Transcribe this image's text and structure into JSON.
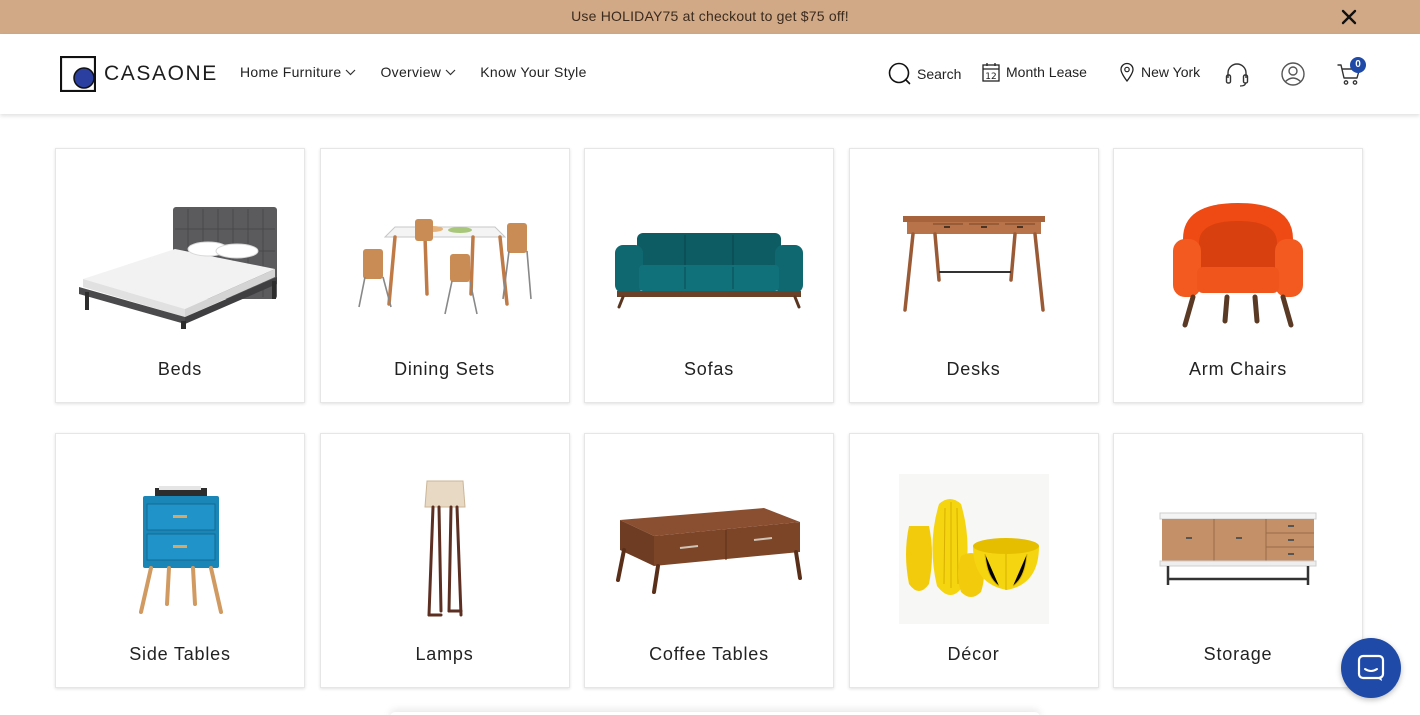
{
  "promo": {
    "text": "Use HOLIDAY75 at checkout to get $75 off!"
  },
  "header": {
    "brand": "CASAONE",
    "nav": [
      {
        "label": "Home Furniture",
        "icon": "chevron-down-icon"
      },
      {
        "label": "Overview",
        "icon": "chevron-down-icon"
      },
      {
        "label": "Know Your Style"
      }
    ],
    "utilities": {
      "search_label": "Search",
      "lease_label": "Month Lease",
      "lease_icon_number": "12",
      "location_label": "New York"
    },
    "cart_count": "0"
  },
  "categories": [
    {
      "label": "Beds",
      "icon": "bed-image"
    },
    {
      "label": "Dining Sets",
      "icon": "dining-set-image"
    },
    {
      "label": "Sofas",
      "icon": "sofa-image"
    },
    {
      "label": "Desks",
      "icon": "desk-image"
    },
    {
      "label": "Arm Chairs",
      "icon": "arm-chair-image"
    },
    {
      "label": "Side Tables",
      "icon": "side-table-image"
    },
    {
      "label": "Lamps",
      "icon": "lamp-image"
    },
    {
      "label": "Coffee Tables",
      "icon": "coffee-table-image"
    },
    {
      "label": "Décor",
      "icon": "decor-image"
    },
    {
      "label": "Storage",
      "icon": "storage-image"
    }
  ],
  "colors": {
    "promo_bg": "#d2a987",
    "accent": "#1f4aa8",
    "sofa": "#0d5c63",
    "arm_chair": "#ef4a14",
    "side_table": "#1a86b8",
    "decor": "#f2cc0c",
    "wood": "#9a5a35"
  }
}
